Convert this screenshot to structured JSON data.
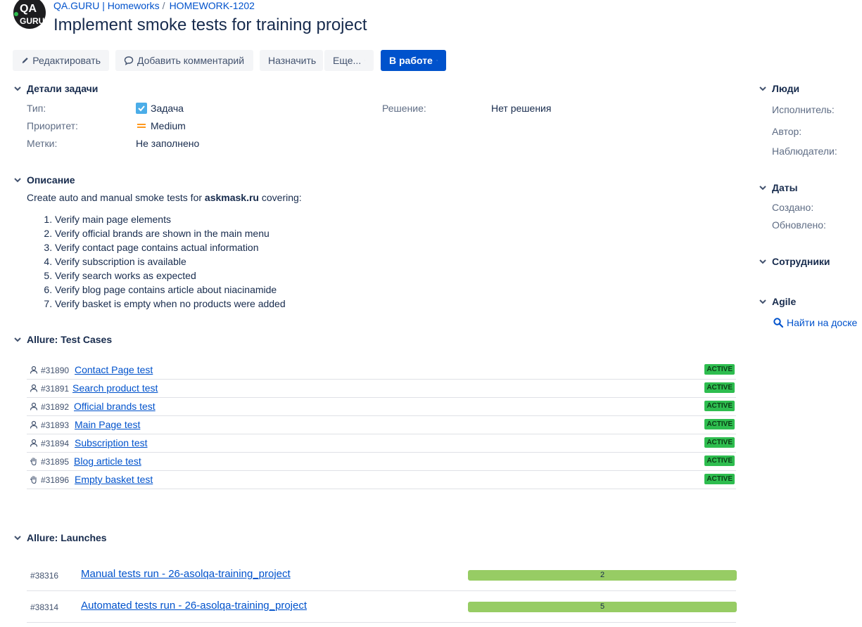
{
  "header": {
    "logo_text": "QA GURU",
    "breadcrumb_project": "QA.GURU | Homeworks",
    "breadcrumb_separator": "/",
    "breadcrumb_issue": "HOMEWORK-1202",
    "title": "Implement smoke tests for training project"
  },
  "toolbar": {
    "edit": "Редактировать",
    "comment": "Добавить комментарий",
    "assign": "Назначить",
    "more": "Еще...",
    "status": "В работе"
  },
  "details": {
    "heading": "Детали задачи",
    "type_label": "Тип:",
    "type_value": "Задача",
    "priority_label": "Приоритет:",
    "priority_value": "Medium",
    "labels_label": "Метки:",
    "labels_value": "Не заполнено",
    "resolution_label": "Решение:",
    "resolution_value": "Нет решения"
  },
  "description": {
    "heading": "Описание",
    "intro_before": "Create auto and manual smoke tests for ",
    "intro_bold": "askmask.ru",
    "intro_after": " covering:",
    "items": [
      "Verify main page elements",
      "Verify official brands are shown in the main menu",
      "Verify contact page contains actual information",
      "Verify subscription is available",
      "Verify search works as expected",
      "Verify blog page contains article about niacinamide",
      "Verify basket is empty when no products were added"
    ]
  },
  "test_cases": {
    "heading": "Allure: Test Cases",
    "rows": [
      {
        "id": "#31890",
        "name": "Contact Page test",
        "status": "ACTIVE",
        "kind": "automated"
      },
      {
        "id": "#31891",
        "name": "Search product test",
        "status": "ACTIVE",
        "kind": "automated"
      },
      {
        "id": "#31892",
        "name": "Official brands test",
        "status": "ACTIVE",
        "kind": "automated"
      },
      {
        "id": "#31893",
        "name": "Main Page test",
        "status": "ACTIVE",
        "kind": "automated"
      },
      {
        "id": "#31894",
        "name": "Subscription test",
        "status": "ACTIVE",
        "kind": "automated"
      },
      {
        "id": "#31895",
        "name": "Blog article test",
        "status": "ACTIVE",
        "kind": "manual"
      },
      {
        "id": "#31896",
        "name": "Empty basket test",
        "status": "ACTIVE",
        "kind": "manual"
      }
    ]
  },
  "launches": {
    "heading": "Allure: Launches",
    "rows": [
      {
        "id": "#38316",
        "name": "Manual tests run - 26-asolqa-training_project",
        "count": "2"
      },
      {
        "id": "#38314",
        "name": "Automated tests run - 26-asolqa-training_project",
        "count": "5"
      }
    ]
  },
  "sidebar": {
    "people_heading": "Люди",
    "assignee_label": "Исполнитель:",
    "reporter_label": "Автор:",
    "watchers_label": "Наблюдатели:",
    "dates_heading": "Даты",
    "created_label": "Создано:",
    "updated_label": "Обновлено:",
    "employees_heading": "Сотрудники",
    "agile_heading": "Agile",
    "find_on_board": "Найти на доске"
  },
  "colors": {
    "link": "#0052cc",
    "primary_button": "#0052cc",
    "badge_active": "#2ebd4f",
    "launch_bar": "#97cc64",
    "priority_medium": "#ff991f",
    "text": "#172b4d"
  },
  "icons": {
    "edit": "pencil-icon",
    "comment": "speech-bubble-icon",
    "status_dropdown": "chevron-down-icon",
    "type": "checkbox-task-icon",
    "priority": "medium-priority-icon",
    "automated": "robot-icon",
    "manual": "hand-icon",
    "search": "search-icon"
  }
}
